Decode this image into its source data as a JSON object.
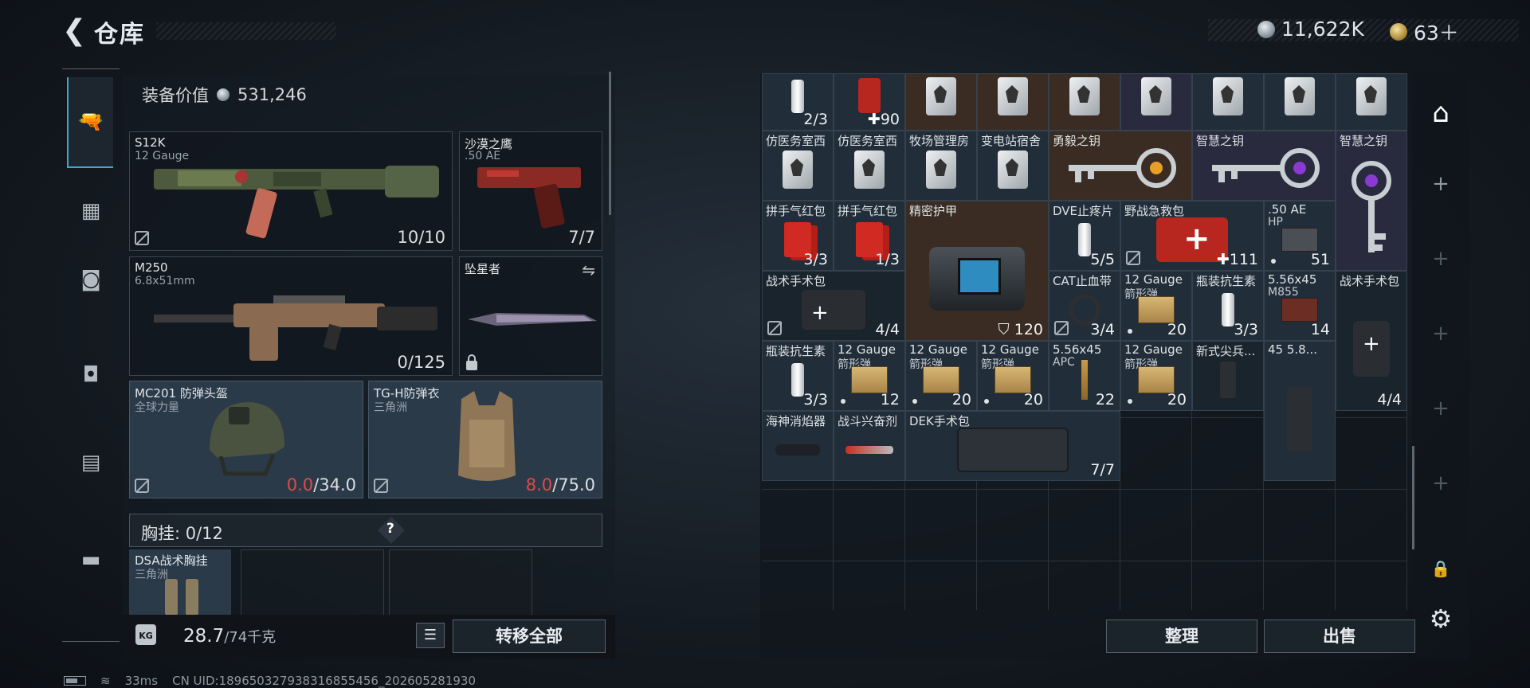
{
  "header": {
    "back_icon": "back-arrow-icon",
    "title": "仓库",
    "silver_currency": "11,622K",
    "gold_currency": "63＋"
  },
  "loadout": {
    "equip_value_label": "装备价值",
    "equip_value": "531,246",
    "slots": {
      "primary": {
        "name": "S12K",
        "sub": "12 Gauge",
        "count": "10/10"
      },
      "pistol": {
        "name": "沙漠之鹰",
        "sub": ".50 AE",
        "count": "7/7"
      },
      "secondary": {
        "name": "M250",
        "sub": "6.8x51mm",
        "count": "0/125"
      },
      "melee": {
        "name": "坠星者"
      },
      "helmet": {
        "name": "MC201 防弹头盔",
        "sub": "全球力量",
        "dur_current": "0.0",
        "dur_max": "/34.0"
      },
      "armor": {
        "name": "TG-H防弹衣",
        "sub": "三角洲",
        "dur_current": "8.0",
        "dur_max": "/75.0"
      }
    },
    "chest_rig": {
      "label": "胸挂: 0/12",
      "help": "?",
      "item_name": "DSA战术胸挂",
      "item_sub": "三角洲"
    },
    "weight": {
      "current": "28.7",
      "max": "/74千克",
      "kg_icon_text": "KG"
    },
    "move_all_label": "转移全部"
  },
  "stash": {
    "rows": [
      [
        {
          "count": "2/3"
        },
        {
          "count": "90",
          "plus": true
        },
        {},
        {},
        {},
        {},
        {},
        {},
        {}
      ],
      [
        {
          "name": "仿医务室西"
        },
        {
          "name": "仿医务室西"
        },
        {
          "name": "牧场管理房"
        },
        {
          "name": "变电站宿舍"
        },
        {
          "name": "勇毅之钥"
        },
        {
          "name": "智慧之钥"
        },
        {
          "name": "智慧之钥"
        }
      ],
      [
        {
          "name": "拼手气红包",
          "count": "3/3"
        },
        {
          "name": "拼手气红包",
          "count": "1/3"
        },
        {
          "name": "精密护甲"
        },
        {
          "name": "DVE止疼片",
          "count": "5/5"
        },
        {
          "name": "野战急救包",
          "count": "111"
        },
        {
          "name": ".50 AE",
          "sub": "HP",
          "count": "51"
        }
      ],
      [
        {
          "name": "战术手术包",
          "count": "4/4"
        },
        {
          "count": "120"
        },
        {
          "name": "CAT止血带",
          "count": "3/4"
        },
        {
          "name": "12 Gauge",
          "sub": "箭形弹",
          "count": "20"
        },
        {
          "name": "瓶装抗生素",
          "count": "3/3"
        },
        {
          "name": "5.56x45",
          "sub": "M855",
          "count": "14"
        },
        {
          "name": "战术手术包",
          "count": "4/4"
        }
      ],
      [
        {
          "name": "瓶装抗生素",
          "count": "3/3"
        },
        {
          "name": "12 Gauge",
          "sub": "箭形弹",
          "count": "12"
        },
        {
          "name": "12 Gauge",
          "sub": "箭形弹",
          "count": "20"
        },
        {
          "name": "12 Gauge",
          "sub": "箭形弹",
          "count": "20"
        },
        {
          "name": "5.56x45",
          "sub": "APC",
          "count": "22"
        },
        {
          "name": "12 Gauge",
          "sub": "箭形弹",
          "count": "20"
        },
        {
          "name": "新式尖兵..."
        },
        {
          "name": "45 5.8..."
        }
      ],
      [
        {
          "name": "海神消焰器"
        },
        {
          "name": "战斗兴奋剂"
        },
        {
          "name": "DEK手术包",
          "count": "7/7"
        }
      ]
    ],
    "sort_label": "整理",
    "sell_label": "出售"
  },
  "status_bar": {
    "ping": "33ms",
    "uid": "CN UID:18965032793831685545​6_202605281930"
  },
  "colors": {
    "accent": "#3ea8c8",
    "damage_red": "#e04a45"
  }
}
